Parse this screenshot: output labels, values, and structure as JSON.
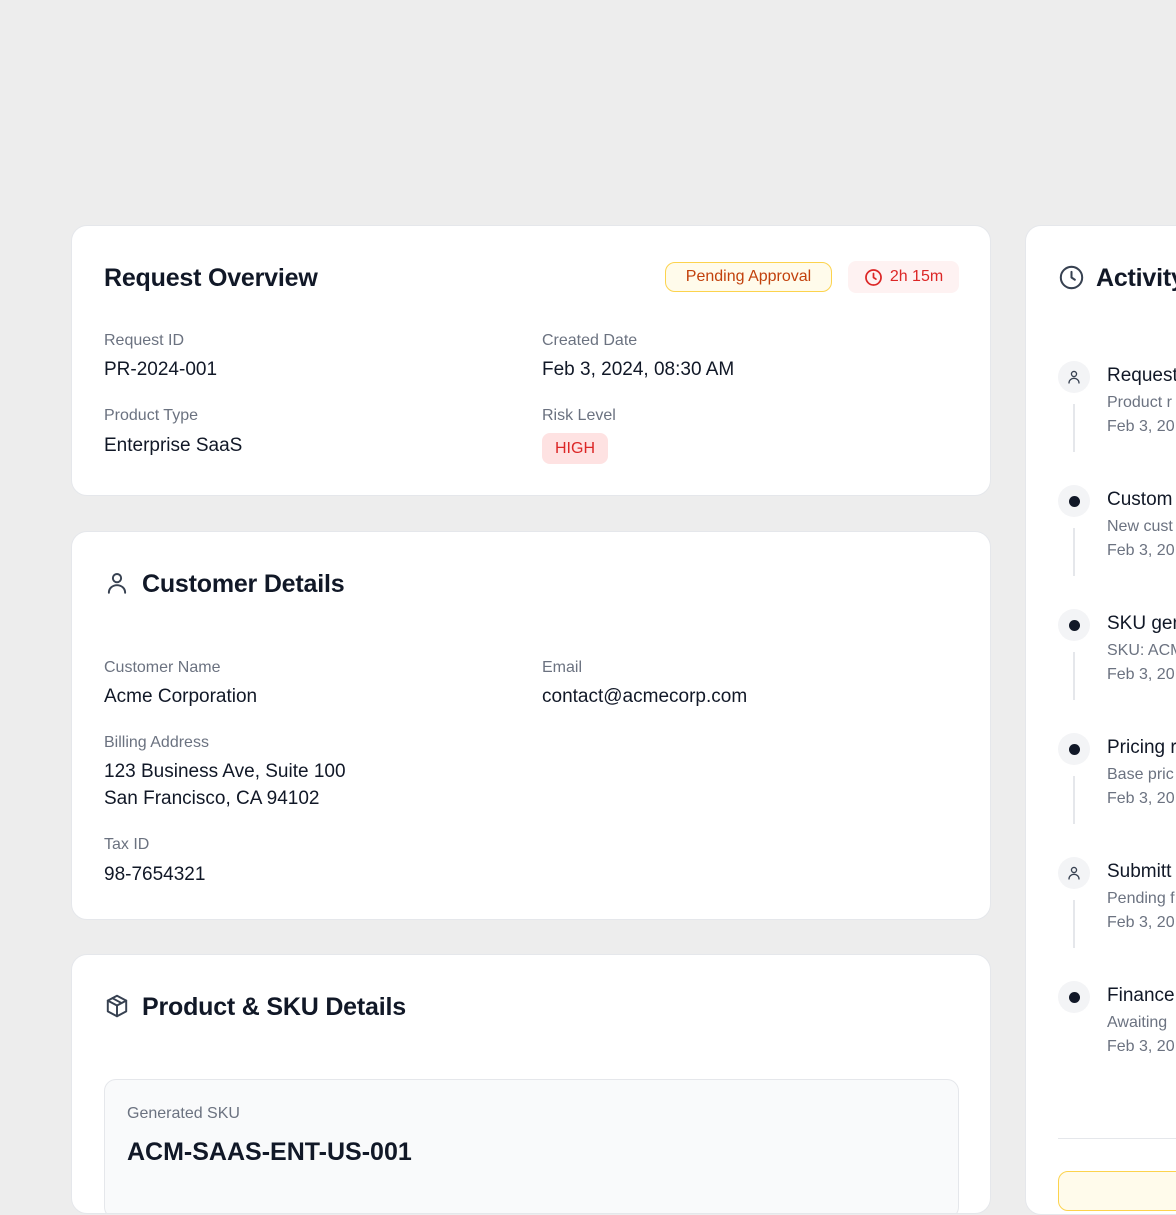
{
  "overview": {
    "title": "Request Overview",
    "status_badge": "Pending Approval",
    "timer": "2h 15m",
    "fields": {
      "request_id_label": "Request ID",
      "request_id_value": "PR-2024-001",
      "created_label": "Created Date",
      "created_value": "Feb 3, 2024, 08:30 AM",
      "product_type_label": "Product Type",
      "product_type_value": "Enterprise SaaS",
      "risk_label": "Risk Level",
      "risk_value": "HIGH"
    }
  },
  "customer": {
    "title": "Customer Details",
    "name_label": "Customer Name",
    "name_value": "Acme Corporation",
    "email_label": "Email",
    "email_value": "contact@acmecorp.com",
    "billing_label": "Billing Address",
    "billing_line1": "123 Business Ave, Suite 100",
    "billing_line2": "San Francisco, CA 94102",
    "tax_label": "Tax ID",
    "tax_value": "98-7654321"
  },
  "product": {
    "title": "Product & SKU Details",
    "sku_label": "Generated SKU",
    "sku_value": "ACM-SAAS-ENT-US-001"
  },
  "activity": {
    "title": "Activity",
    "items": [
      {
        "title": "Request",
        "desc": "Product r",
        "date": "Feb 3, 20",
        "icon": "user-icon"
      },
      {
        "title": "Custom",
        "desc": "New cust",
        "date": "Feb 3, 20",
        "icon": "dot"
      },
      {
        "title": "SKU gen",
        "desc": "SKU: ACM",
        "date": "Feb 3, 20",
        "icon": "dot"
      },
      {
        "title": "Pricing r",
        "desc": "Base pric",
        "date": "Feb 3, 20",
        "icon": "dot"
      },
      {
        "title": "Submitt",
        "desc": "Pending f",
        "date": "Feb 3, 20",
        "icon": "user-icon"
      },
      {
        "title": "Finance",
        "desc": "Awaiting",
        "date": "Feb 3, 20",
        "icon": "dot"
      }
    ]
  },
  "colors": {
    "background": "#ededed",
    "card": "#ffffff",
    "pending_text": "#c2410c",
    "pending_border": "#fcd34d",
    "danger": "#dc2626",
    "danger_bg": "#fee2e2"
  }
}
